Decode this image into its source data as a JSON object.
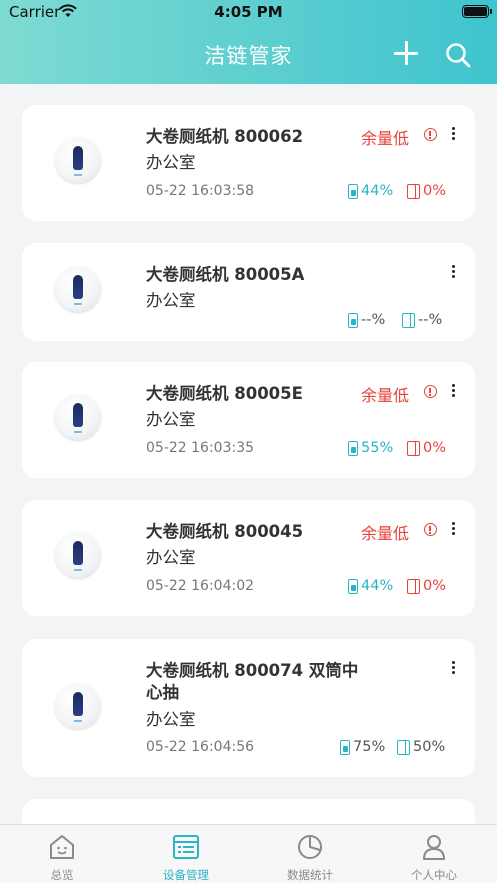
{
  "status_bar": {
    "carrier": "Carrier",
    "time": "4:05 PM"
  },
  "nav": {
    "title": "洁链管家"
  },
  "devices": [
    {
      "title": "大卷厕纸机 800062",
      "location": "办公室",
      "time": "05-22 16:03:58",
      "warning": "余量低",
      "battery": "44%",
      "paper": "0%",
      "battery_color": "cyan",
      "paper_color": "red"
    },
    {
      "title": "大卷厕纸机 80005A",
      "location": "办公室",
      "time": "",
      "warning": "",
      "battery": "--%",
      "paper": "--%",
      "battery_color": "cyan",
      "paper_color": "cyan"
    },
    {
      "title": "大卷厕纸机 80005E",
      "location": "办公室",
      "time": "05-22 16:03:35",
      "warning": "余量低",
      "battery": "55%",
      "paper": "0%",
      "battery_color": "cyan",
      "paper_color": "red"
    },
    {
      "title": "大卷厕纸机 800045",
      "location": "办公室",
      "time": "05-22 16:04:02",
      "warning": "余量低",
      "battery": "44%",
      "paper": "0%",
      "battery_color": "cyan",
      "paper_color": "red"
    },
    {
      "title": "大卷厕纸机 800074  双筒中心抽",
      "location": "办公室",
      "time": "05-22 16:04:56",
      "warning": "",
      "battery": "75%",
      "paper": "50%",
      "battery_color": "cyan",
      "paper_color": "cyan"
    }
  ],
  "tabs": [
    {
      "label": "总览",
      "active": false
    },
    {
      "label": "设备管理",
      "active": true
    },
    {
      "label": "数据统计",
      "active": false
    },
    {
      "label": "个人中心",
      "active": false
    }
  ],
  "colors": {
    "accent": "#2bb5c4",
    "warning": "#e6433b",
    "header_start": "#7edbd2",
    "header_end": "#3ec4cf"
  }
}
